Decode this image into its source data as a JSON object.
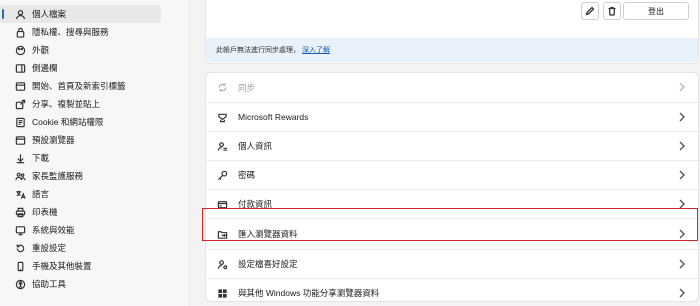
{
  "sidebar": {
    "items": [
      {
        "label": "個人檔案",
        "icon": "profile-icon",
        "active": true
      },
      {
        "label": "隱私權、搜尋與服務",
        "icon": "lock-icon"
      },
      {
        "label": "外觀",
        "icon": "appearance-icon"
      },
      {
        "label": "側邊欄",
        "icon": "sidebar-icon"
      },
      {
        "label": "開始、首頁及新索引標籤",
        "icon": "home-tab-icon"
      },
      {
        "label": "分享、複製並貼上",
        "icon": "share-icon"
      },
      {
        "label": "Cookie 和網站權限",
        "icon": "cookie-icon"
      },
      {
        "label": "預設瀏覽器",
        "icon": "browser-icon"
      },
      {
        "label": "下載",
        "icon": "download-icon"
      },
      {
        "label": "家長監護服務",
        "icon": "family-icon"
      },
      {
        "label": "語言",
        "icon": "language-icon"
      },
      {
        "label": "印表機",
        "icon": "printer-icon"
      },
      {
        "label": "系統與效能",
        "icon": "system-icon"
      },
      {
        "label": "重設設定",
        "icon": "reset-icon"
      },
      {
        "label": "手機及其他裝置",
        "icon": "phone-icon"
      },
      {
        "label": "協助工具",
        "icon": "accessibility-icon"
      }
    ]
  },
  "profile": {
    "signout_label": "登出",
    "sync_message": "此帳戶無法進行同步處理，",
    "sync_link": "深入了解"
  },
  "settings": {
    "rows": [
      {
        "label": "同步",
        "icon": "sync-icon",
        "disabled": true
      },
      {
        "label": "Microsoft Rewards",
        "icon": "rewards-icon"
      },
      {
        "label": "個人資訊",
        "icon": "personal-info-icon"
      },
      {
        "label": "密碼",
        "icon": "key-icon"
      },
      {
        "label": "付款資訊",
        "icon": "card-icon"
      },
      {
        "label": "匯入瀏覽器資料",
        "icon": "import-folder-icon",
        "highlighted": true
      },
      {
        "label": "設定檔喜好設定",
        "icon": "profile-prefs-icon"
      },
      {
        "label": "與其他 Windows 功能分享瀏覽器資料",
        "icon": "windows-icon"
      }
    ]
  },
  "colors": {
    "accent": "#2a69b4",
    "highlight": "#d4262a",
    "link": "#0f5fb0"
  }
}
